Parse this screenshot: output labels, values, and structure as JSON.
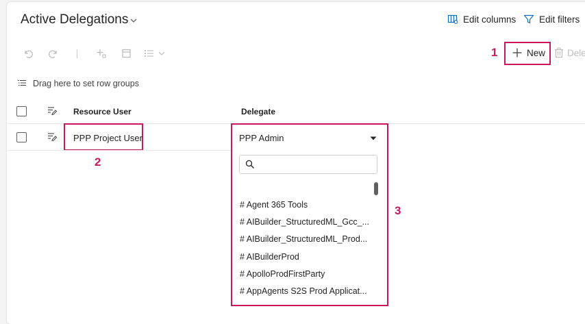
{
  "header": {
    "title": "Active Delegations",
    "edit_columns_label": "Edit columns",
    "edit_filters_label": "Edit filters"
  },
  "toolbar": {
    "new_label": "New",
    "delete_label": "Dele",
    "icons": [
      "undo-icon",
      "redo-icon",
      "divider",
      "add-child-icon",
      "open-record-icon",
      "list-options-icon"
    ]
  },
  "group_hint": "Drag here to set row groups",
  "columns": [
    "Resource User",
    "Delegate"
  ],
  "rows": [
    {
      "resource_user": "PPP Project User",
      "delegate": "PPP Admin"
    }
  ],
  "dropdown": {
    "selected": "PPP Admin",
    "search_placeholder": "",
    "items": [
      "# Agent 365 Tools",
      "# AIBuilder_StructuredML_Gcc_...",
      "# AIBuilder_StructuredML_Prod...",
      "# AIBuilderProd",
      "# ApolloProdFirstParty",
      "# AppAgents S2S Prod Applicat..."
    ]
  },
  "callouts": {
    "c1": "1",
    "c2": "2",
    "c3": "3"
  },
  "colors": {
    "accent": "#c8175e",
    "link_icon": "#0f6cbd"
  }
}
